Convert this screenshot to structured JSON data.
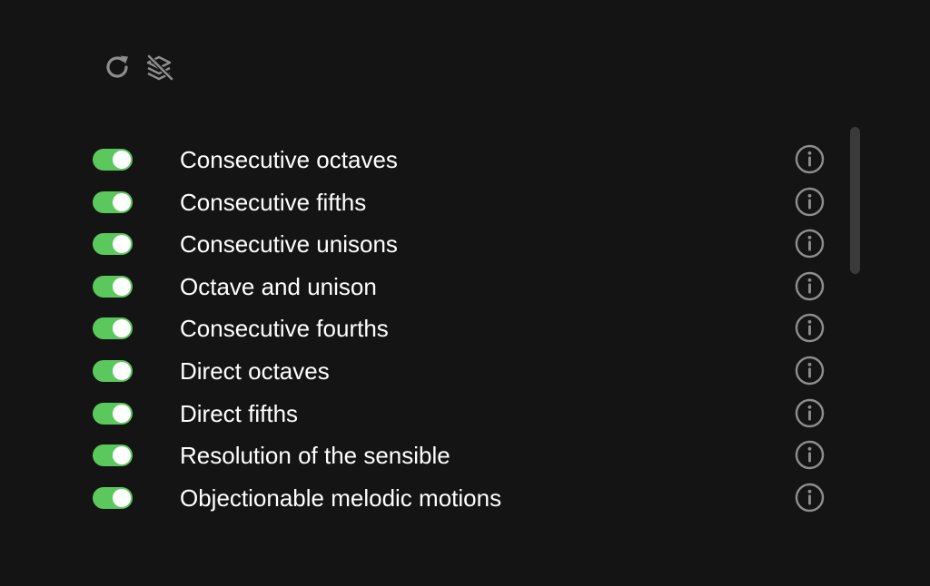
{
  "toolbar": {
    "reset_icon": "refresh-icon",
    "layers_icon": "layers-off-icon"
  },
  "rules": [
    {
      "label": "Consecutive octaves",
      "enabled": true
    },
    {
      "label": "Consecutive fifths",
      "enabled": true
    },
    {
      "label": "Consecutive unisons",
      "enabled": true
    },
    {
      "label": "Octave and unison",
      "enabled": true
    },
    {
      "label": "Consecutive fourths",
      "enabled": true
    },
    {
      "label": "Direct octaves",
      "enabled": true
    },
    {
      "label": "Direct fifths",
      "enabled": true
    },
    {
      "label": "Resolution of the sensible",
      "enabled": true
    },
    {
      "label": "Objectionable melodic motions",
      "enabled": true
    }
  ],
  "colors": {
    "background": "#141414",
    "toggle_on": "#5bc85d",
    "icon": "#8e8e8e",
    "text": "#ffffff"
  }
}
